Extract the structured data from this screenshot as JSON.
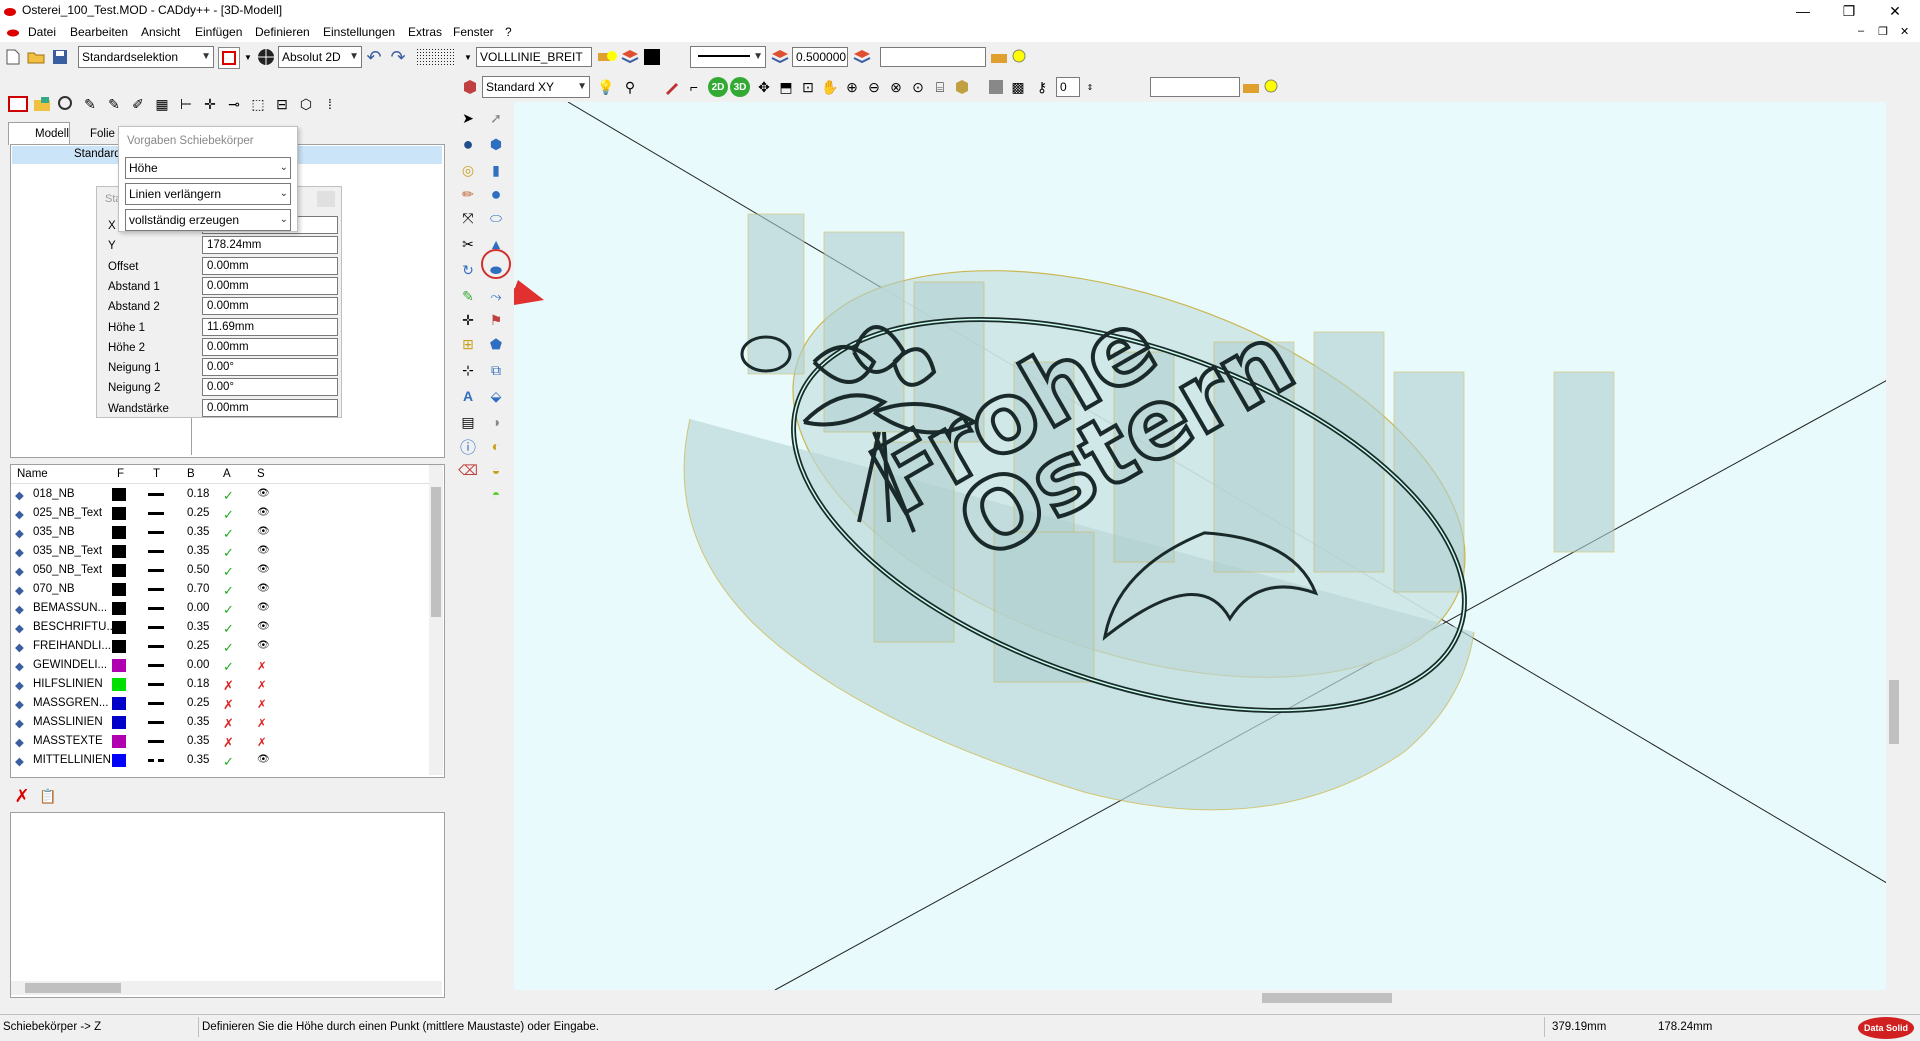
{
  "window": {
    "title": "Osterei_100_Test.MOD  -  CADdy++ - [3D-Modell]"
  },
  "menu": [
    "Datei",
    "Bearbeiten",
    "Ansicht",
    "Einfügen",
    "Definieren",
    "Einstellungen",
    "Extras",
    "Fenster",
    "?"
  ],
  "toolbar1": {
    "selection_mode": "Standardselektion",
    "coord_mode": "Absolut 2D",
    "line_type": "VOLLLINIE_BREIT",
    "line_width": "0.500000",
    "search_value": ""
  },
  "toolbar2": {
    "view": "Standard XY",
    "btn_2d": "2D",
    "btn_3d": "3D",
    "layer_value": "0",
    "search_value": ""
  },
  "left": {
    "tabs": [
      "Modell",
      "Folie"
    ],
    "tree_item": "Standard",
    "popup": {
      "title": "Vorgaben Schiebekörper",
      "options": [
        "Höhe",
        "Linien verlängern",
        "vollständig erzeugen"
      ]
    },
    "props": {
      "title": "Sta",
      "rows": [
        {
          "label": "X",
          "value": ""
        },
        {
          "label": "Y",
          "value": "178.24mm"
        },
        {
          "label": "Offset",
          "value": "0.00mm"
        },
        {
          "label": "Abstand 1",
          "value": "0.00mm"
        },
        {
          "label": "Abstand 2",
          "value": "0.00mm"
        },
        {
          "label": "Höhe 1",
          "value": "11.69mm"
        },
        {
          "label": "Höhe 2",
          "value": "0.00mm"
        },
        {
          "label": "Neigung 1",
          "value": "0.00°"
        },
        {
          "label": "Neigung 2",
          "value": "0.00°"
        },
        {
          "label": "Wandstärke",
          "value": "0.00mm"
        }
      ]
    },
    "layer_headers": [
      "Name",
      "F",
      "T",
      "B",
      "A",
      "S"
    ],
    "layers": [
      {
        "name": "018_NB",
        "color": "#000000",
        "b": "0.18",
        "a": "check",
        "s": "eye",
        "line": "solid"
      },
      {
        "name": "025_NB_Text",
        "color": "#000000",
        "b": "0.25",
        "a": "check",
        "s": "eye",
        "line": "solid"
      },
      {
        "name": "035_NB",
        "color": "#000000",
        "b": "0.35",
        "a": "check",
        "s": "eye",
        "line": "solid"
      },
      {
        "name": "035_NB_Text",
        "color": "#000000",
        "b": "0.35",
        "a": "check",
        "s": "eye",
        "line": "solid"
      },
      {
        "name": "050_NB_Text",
        "color": "#000000",
        "b": "0.50",
        "a": "check",
        "s": "eye",
        "line": "solid"
      },
      {
        "name": "070_NB",
        "color": "#000000",
        "b": "0.70",
        "a": "check",
        "s": "eye",
        "line": "solid"
      },
      {
        "name": "BEMASSUN...",
        "color": "#000000",
        "b": "0.00",
        "a": "check",
        "s": "eye",
        "line": "solid"
      },
      {
        "name": "BESCHRIFTU...",
        "color": "#000000",
        "b": "0.35",
        "a": "check",
        "s": "eye",
        "line": "solid"
      },
      {
        "name": "FREIHANDLI...",
        "color": "#000000",
        "b": "0.25",
        "a": "check",
        "s": "eye",
        "line": "solid"
      },
      {
        "name": "GEWINDELI...",
        "color": "#b000b0",
        "b": "0.00",
        "a": "check",
        "s": "eye-x",
        "line": "solid"
      },
      {
        "name": "HILFSLINIEN",
        "color": "#00e000",
        "b": "0.18",
        "a": "x",
        "s": "eye-x",
        "line": "solid"
      },
      {
        "name": "MASSGREN...",
        "color": "#0000c8",
        "b": "0.25",
        "a": "x",
        "s": "eye-x",
        "line": "solid"
      },
      {
        "name": "MASSLINIEN",
        "color": "#0000c8",
        "b": "0.35",
        "a": "x",
        "s": "eye-x",
        "line": "solid"
      },
      {
        "name": "MASSTEXTE",
        "color": "#b000b0",
        "b": "0.35",
        "a": "x",
        "s": "eye-x",
        "line": "solid"
      },
      {
        "name": "MITTELLINIEN",
        "color": "#0000ff",
        "b": "0.35",
        "a": "check",
        "s": "eye",
        "line": "dash"
      }
    ]
  },
  "status": {
    "mode": "Schiebekörper -> Z",
    "hint": "Definieren Sie die Höhe durch einen Punkt (mittlere Maustaste) oder Eingabe.",
    "x": "379.19mm",
    "y": "178.24mm",
    "logo": "Data Solid"
  },
  "model_text": {
    "line1": "Frohe",
    "line2": "Ostern"
  }
}
